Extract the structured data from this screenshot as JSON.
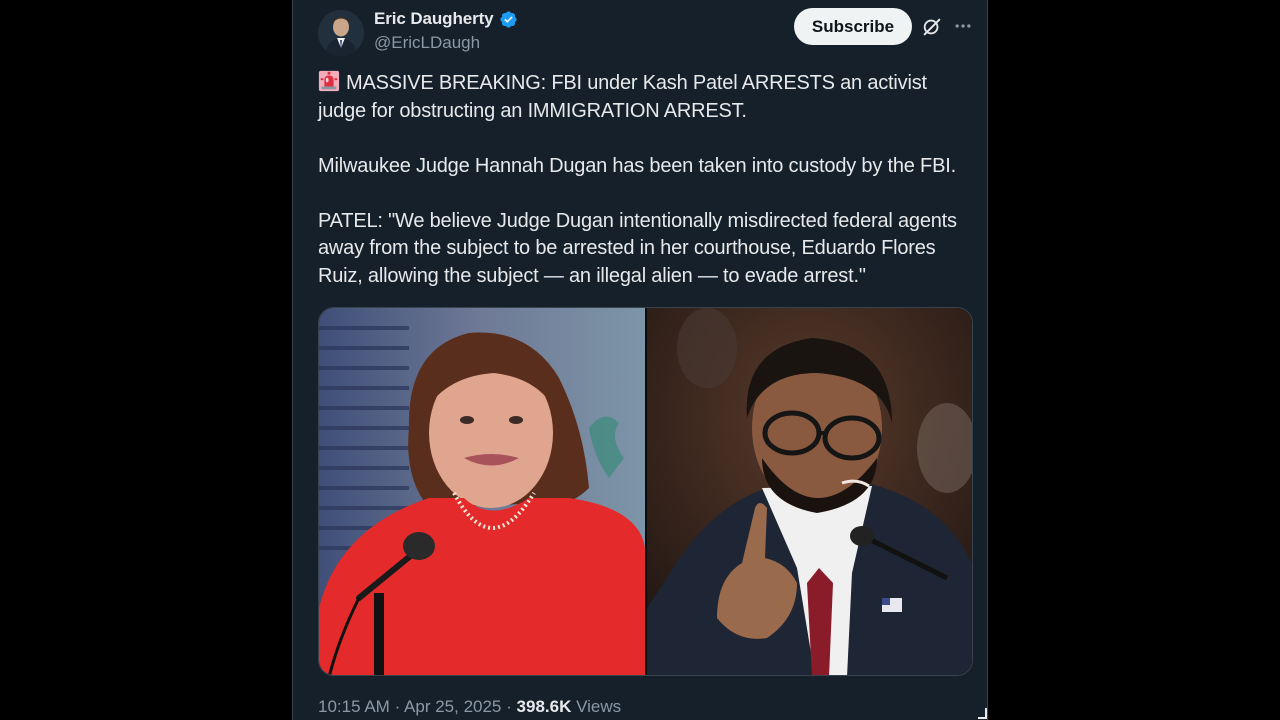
{
  "author": {
    "display_name": "Eric Daugherty",
    "handle": "@EricLDaugh",
    "verified_icon": "verified-badge-icon",
    "verified_color": "#1d9bf0"
  },
  "header": {
    "subscribe_label": "Subscribe",
    "grok_icon": "grok-icon",
    "more_icon": "more-horizontal-icon"
  },
  "tweet": {
    "paragraphs": [
      "MASSIVE BREAKING: FBI under Kash Patel ARRESTS an activist judge for obstructing an IMMIGRATION ARREST.",
      "Milwaukee Judge Hannah Dugan has been taken into custody by the FBI.",
      "PATEL: \"We believe Judge Dugan intentionally misdirected federal agents away from the subject to be arrested in her courthouse, Eduardo Flores Ruiz, allowing the subject — an illegal alien — to evade arrest.\""
    ],
    "leading_emoji": "police-light-emoji"
  },
  "media": {
    "photos": [
      "photo-woman-red-dress-microphone",
      "photo-man-glasses-pointing"
    ]
  },
  "meta": {
    "time": "10:15 AM",
    "separator": "·",
    "date": "Apr 25, 2025",
    "views_count": "398.6K",
    "views_label": "Views"
  },
  "colors": {
    "background": "#15202b",
    "text": "#e7e9ea",
    "muted": "#8b98a5",
    "border": "#38444d"
  }
}
